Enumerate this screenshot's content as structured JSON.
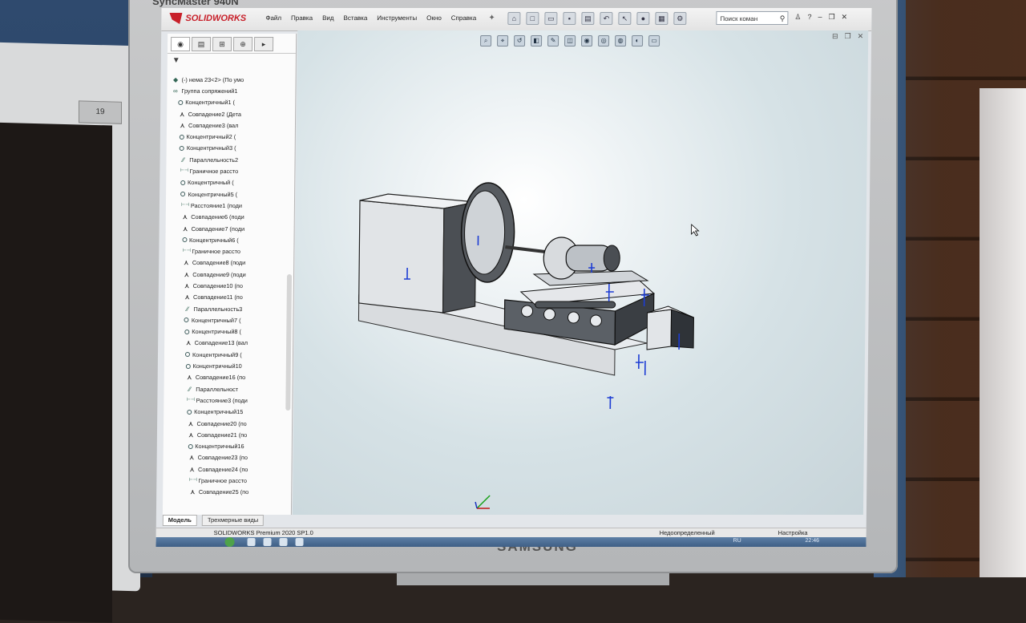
{
  "monitor": {
    "model_label": "SyncMaster 940N",
    "brand_label": "SAMSUNG",
    "left_monitor_brand": "19"
  },
  "app": {
    "logo_text": "SOLIDWORKS",
    "menu": [
      "Файл",
      "Правка",
      "Вид",
      "Вставка",
      "Инструменты",
      "Окно",
      "Справка"
    ],
    "search_placeholder": "Поиск коман",
    "toolbar_icons": [
      "home-icon",
      "new-doc-icon",
      "open-icon",
      "save-icon",
      "print-icon",
      "undo-icon",
      "select-icon",
      "traffic-light-icon",
      "doc-props-icon",
      "options-icon"
    ]
  },
  "feature_tree": {
    "root": "(-) нема 23<2> (По умо",
    "group": "Группа сопряжений1",
    "items": [
      {
        "type": "conc",
        "label": "Концентричный1 ("
      },
      {
        "type": "coinc",
        "label": "Совпадение2 (Дета"
      },
      {
        "type": "coinc",
        "label": "Совпадение3 (вал"
      },
      {
        "type": "conc",
        "label": "Концентричный2 ("
      },
      {
        "type": "conc",
        "label": "Концентричный3 ("
      },
      {
        "type": "par",
        "label": "Параллельность2"
      },
      {
        "type": "dist",
        "label": "Граничное рассто"
      },
      {
        "type": "conc",
        "label": "Концентричный ("
      },
      {
        "type": "conc",
        "label": "Концентричный5 ("
      },
      {
        "type": "dist",
        "label": "Расстояние1 (поди"
      },
      {
        "type": "coinc",
        "label": "Совпадение6 (поди"
      },
      {
        "type": "coinc",
        "label": "Совпадение7 (поди"
      },
      {
        "type": "conc",
        "label": "Концентричный6 ("
      },
      {
        "type": "dist",
        "label": "Граничное рассто"
      },
      {
        "type": "coinc",
        "label": "Совпадение8 (поди"
      },
      {
        "type": "coinc",
        "label": "Совпадение9 (поди"
      },
      {
        "type": "coinc",
        "label": "Совпадение10 (по"
      },
      {
        "type": "coinc",
        "label": "Совпадение11 (по"
      },
      {
        "type": "par",
        "label": "Параллельность3"
      },
      {
        "type": "conc",
        "label": "Концентричный7 ("
      },
      {
        "type": "conc",
        "label": "Концентричный8 ("
      },
      {
        "type": "coinc",
        "label": "Совпадение13 (вал"
      },
      {
        "type": "conc",
        "label": "Концентричный9 ("
      },
      {
        "type": "conc",
        "label": "Концентричный10"
      },
      {
        "type": "coinc",
        "label": "Совпадение16 (по"
      },
      {
        "type": "par",
        "label": "Параллельност"
      },
      {
        "type": "dist",
        "label": "Расстояние3 (поди"
      },
      {
        "type": "conc",
        "label": "Концентричный15"
      },
      {
        "type": "coinc",
        "label": "Совпадение20 (по"
      },
      {
        "type": "coinc",
        "label": "Совпадение21 (по"
      },
      {
        "type": "conc",
        "label": "Концентричный16"
      },
      {
        "type": "coinc",
        "label": "Совпадение23 (по"
      },
      {
        "type": "coinc",
        "label": "Совпадение24 (по"
      },
      {
        "type": "dist",
        "label": "Граничное рассто"
      },
      {
        "type": "coinc",
        "label": "Совпадение25 (по"
      },
      {
        "type": "coinc",
        "label": "Совпадение27 (по"
      }
    ]
  },
  "bottom_tabs": [
    "Модель",
    "Трехмерные виды"
  ],
  "status": {
    "product": "SOLIDWORKS Premium 2020 SP1.0",
    "state": "Недоопределенный",
    "settings": "Настройка"
  },
  "taskbar": {
    "lang": "RU",
    "time": "22:46"
  }
}
